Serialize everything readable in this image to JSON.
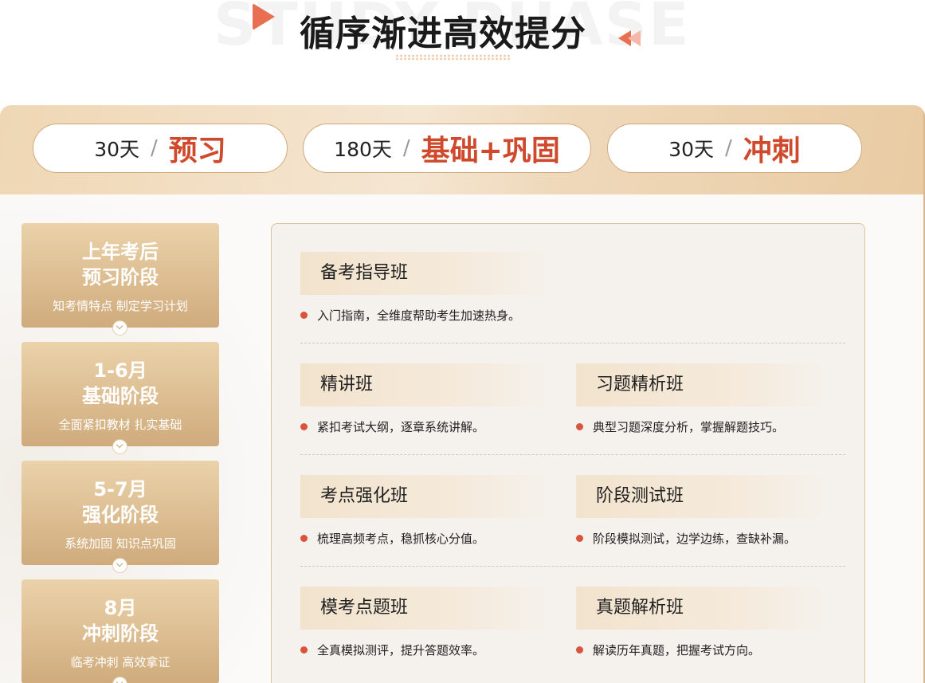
{
  "header": {
    "title": "循序渐进高效提分",
    "background_word": "STUDY PHASE"
  },
  "phases": [
    {
      "days": "30天",
      "name": "预习"
    },
    {
      "days": "180天",
      "name": "基础+巩固"
    },
    {
      "days": "30天",
      "name": "冲刺"
    }
  ],
  "stages": [
    {
      "title": "上年考后\n预习阶段",
      "subtitle": "知考情特点 制定学习计划"
    },
    {
      "title": "1-6月\n基础阶段",
      "subtitle": "全面紧扣教材 扎实基础"
    },
    {
      "title": "5-7月\n强化阶段",
      "subtitle": "系统加固 知识点巩固"
    },
    {
      "title": "8月\n冲刺阶段",
      "subtitle": "临考冲刺 高效拿证"
    }
  ],
  "courses": [
    {
      "name": "备考指导班",
      "desc": "入门指南，全维度帮助考生加速热身。"
    },
    {
      "name": "精讲班",
      "desc": "紧扣考试大纲，逐章系统讲解。"
    },
    {
      "name": "习题精析班",
      "desc": "典型习题深度分析，掌握解题技巧。"
    },
    {
      "name": "考点强化班",
      "desc": "梳理高频考点，稳抓核心分值。"
    },
    {
      "name": "阶段测试班",
      "desc": "阶段模拟测试，边学边练，查缺补漏。"
    },
    {
      "name": "模考点题班",
      "desc": "全真模拟测评，提升答题效率。"
    },
    {
      "name": "真题解析班",
      "desc": "解读历年真题，把握考试方向。"
    }
  ],
  "colors": {
    "accent_red": "#cf4a2c",
    "gold": "#dcbd91",
    "bullet": "#d9543a"
  }
}
